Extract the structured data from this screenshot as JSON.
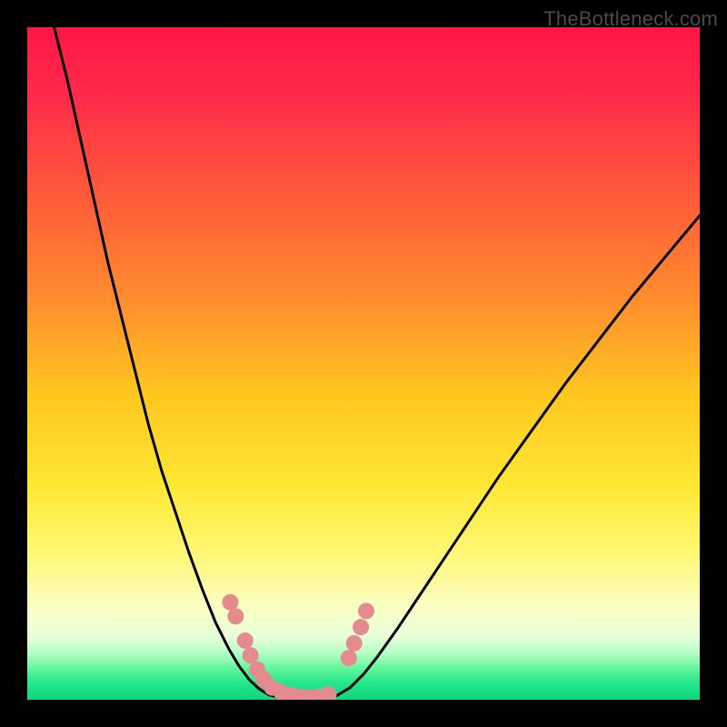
{
  "watermark": {
    "text": "TheBottleneck.com"
  },
  "chart_data": {
    "type": "line",
    "title": "",
    "xlabel": "",
    "ylabel": "",
    "xlim": [
      0,
      100
    ],
    "ylim": [
      0,
      100
    ],
    "grid": false,
    "legend": false,
    "gradient_stops": [
      {
        "offset": 0,
        "color": "#ff1744"
      },
      {
        "offset": 0.1,
        "color": "#ff2a4a"
      },
      {
        "offset": 0.25,
        "color": "#ff5a3a"
      },
      {
        "offset": 0.4,
        "color": "#ff8b2e"
      },
      {
        "offset": 0.55,
        "color": "#ffc81f"
      },
      {
        "offset": 0.68,
        "color": "#ffe733"
      },
      {
        "offset": 0.78,
        "color": "#fff773"
      },
      {
        "offset": 0.86,
        "color": "#fbffc2"
      },
      {
        "offset": 0.905,
        "color": "#e8ffda"
      },
      {
        "offset": 0.93,
        "color": "#b6ffc4"
      },
      {
        "offset": 0.955,
        "color": "#5ff59b"
      },
      {
        "offset": 0.975,
        "color": "#23e78a"
      },
      {
        "offset": 1.0,
        "color": "#14d47f"
      }
    ],
    "series": [
      {
        "name": "curve-left",
        "type": "line",
        "stroke": "#000000",
        "stroke_width": 3,
        "points": [
          {
            "x": 4,
            "y": 100
          },
          {
            "x": 6,
            "y": 92
          },
          {
            "x": 8,
            "y": 83
          },
          {
            "x": 10,
            "y": 74
          },
          {
            "x": 12,
            "y": 65
          },
          {
            "x": 14,
            "y": 57
          },
          {
            "x": 16,
            "y": 49
          },
          {
            "x": 18,
            "y": 41
          },
          {
            "x": 20,
            "y": 34
          },
          {
            "x": 22,
            "y": 28
          },
          {
            "x": 24,
            "y": 22
          },
          {
            "x": 26,
            "y": 16.5
          },
          {
            "x": 28,
            "y": 11.5
          },
          {
            "x": 30,
            "y": 7.5
          },
          {
            "x": 31.5,
            "y": 5
          },
          {
            "x": 33,
            "y": 3
          },
          {
            "x": 34.5,
            "y": 1.6
          },
          {
            "x": 36,
            "y": 0.7
          },
          {
            "x": 38,
            "y": 0.25
          },
          {
            "x": 40,
            "y": 0.1
          }
        ]
      },
      {
        "name": "floor",
        "type": "line",
        "stroke": "#000000",
        "stroke_width": 3,
        "points": [
          {
            "x": 40,
            "y": 0.1
          },
          {
            "x": 42,
            "y": 0.08
          },
          {
            "x": 44,
            "y": 0.1
          }
        ]
      },
      {
        "name": "curve-right",
        "type": "line",
        "stroke": "#000000",
        "stroke_width": 3,
        "points": [
          {
            "x": 44,
            "y": 0.1
          },
          {
            "x": 46,
            "y": 0.6
          },
          {
            "x": 48,
            "y": 1.8
          },
          {
            "x": 50,
            "y": 3.8
          },
          {
            "x": 52,
            "y": 6.3
          },
          {
            "x": 55,
            "y": 10.5
          },
          {
            "x": 58,
            "y": 15
          },
          {
            "x": 62,
            "y": 21
          },
          {
            "x": 66,
            "y": 27
          },
          {
            "x": 70,
            "y": 33
          },
          {
            "x": 75,
            "y": 40
          },
          {
            "x": 80,
            "y": 47
          },
          {
            "x": 85,
            "y": 53.5
          },
          {
            "x": 90,
            "y": 60
          },
          {
            "x": 95,
            "y": 66
          },
          {
            "x": 100,
            "y": 72
          }
        ]
      },
      {
        "name": "dots-left",
        "type": "scatter",
        "fill": "#e58a8f",
        "radius": 9,
        "points": [
          {
            "x": 30.2,
            "y": 14.5
          },
          {
            "x": 31.0,
            "y": 12.4
          },
          {
            "x": 32.4,
            "y": 8.8
          },
          {
            "x": 33.2,
            "y": 6.6
          },
          {
            "x": 34.2,
            "y": 4.5
          },
          {
            "x": 35.2,
            "y": 3.0
          },
          {
            "x": 36.4,
            "y": 1.8
          },
          {
            "x": 37.8,
            "y": 1.1
          },
          {
            "x": 39.2,
            "y": 0.7
          },
          {
            "x": 40.6,
            "y": 0.45
          },
          {
            "x": 42.0,
            "y": 0.35
          },
          {
            "x": 43.4,
            "y": 0.45
          },
          {
            "x": 44.8,
            "y": 0.8
          }
        ]
      },
      {
        "name": "dots-right",
        "type": "scatter",
        "fill": "#e58a8f",
        "radius": 9,
        "points": [
          {
            "x": 47.8,
            "y": 6.2
          },
          {
            "x": 48.6,
            "y": 8.4
          },
          {
            "x": 49.6,
            "y": 10.8
          },
          {
            "x": 50.4,
            "y": 13.2
          }
        ]
      }
    ]
  }
}
